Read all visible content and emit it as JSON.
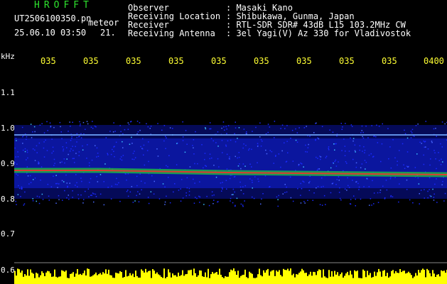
{
  "header": {
    "app_title": "HROFFT",
    "file_name": "UT2506100350.pn",
    "mode": "meteor",
    "date_time": "25.06.10 03:50",
    "count": "21.",
    "info": [
      {
        "label": "Observer",
        "value": ": Masaki Kano"
      },
      {
        "label": "Receiving Location",
        "value": ": Shibukawa, Gunma, Japan"
      },
      {
        "label": "Receiver",
        "value": ": RTL-SDR SDR# 43dB L15 103.2MHz CW"
      },
      {
        "label": "Receiving Antenna",
        "value": ": 3el Yagi(V) Az 330 for Vladivostok"
      }
    ]
  },
  "axis": {
    "unit": "kHz",
    "time_ticks": [
      "035",
      "035",
      "035",
      "035",
      "035",
      "035",
      "035",
      "035",
      "035",
      "0400"
    ],
    "freq_ticks": [
      "1.1",
      "1.0",
      "0.9",
      "0.8",
      "0.7",
      "0.6"
    ]
  },
  "colors": {
    "header_green": "#2ee32e",
    "text_white": "#ffffff",
    "tick_yellow": "#ffff33",
    "background": "#000000",
    "noise_blue": "#1a2aff",
    "signal_red": "#ff2020",
    "meter_yellow": "#ffff00"
  }
}
